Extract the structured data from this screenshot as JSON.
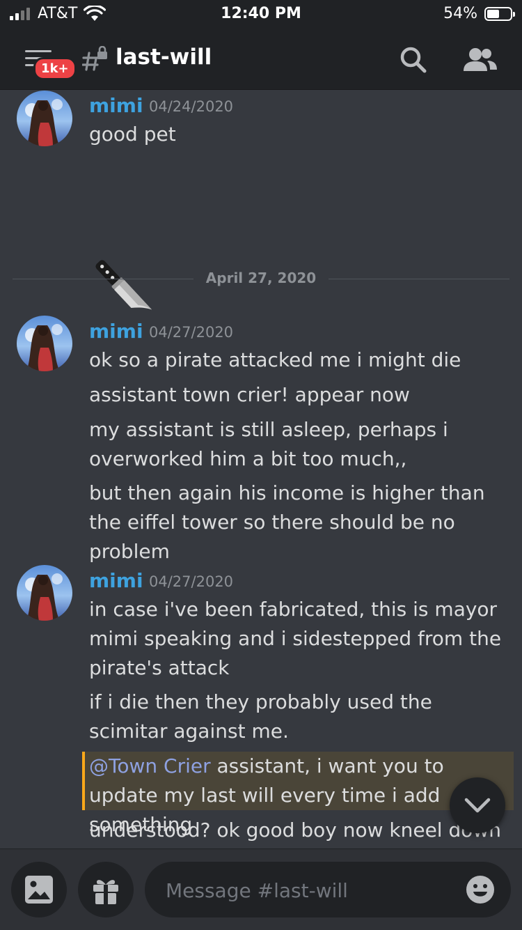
{
  "status_bar": {
    "carrier": "AT&T",
    "time": "12:40 PM",
    "battery_percent": "54%",
    "battery_level": 0.54
  },
  "header": {
    "unread_badge": "1k+",
    "channel_name": "last-will",
    "icons": [
      "menu-icon",
      "locked-channel-icon",
      "search-icon",
      "members-icon"
    ]
  },
  "messages": [
    {
      "author": "mimi",
      "timestamp": "04/24/2020",
      "lines": [
        "good pet"
      ],
      "emoji": "kitchen-knife"
    },
    {
      "author": "mimi",
      "timestamp": "04/27/2020",
      "lines": [
        "ok so a pirate attacked me i might die",
        "assistant town crier! appear now",
        "my assistant is still asleep, perhaps i overworked him a bit too much,,",
        "but then again his income is higher than the eiffel tower so there should be no problem"
      ]
    },
    {
      "author": "mimi",
      "timestamp": "04/27/2020",
      "lines": [
        "in case i've been fabricated, this is mayor mimi speaking and i sidestepped from the pirate's attack",
        "if i die then they probably used the scimitar against me.",
        "understood? ok good boy now kneel down"
      ],
      "mention_line": {
        "mention": "@Town Crier",
        "text": " assistant, i want you to update my last will every time i add something"
      }
    }
  ],
  "date_divider": "April 27, 2020",
  "composer": {
    "placeholder": "Message #last-will",
    "icons": [
      "image-icon",
      "gift-icon",
      "emoji-icon"
    ]
  },
  "colors": {
    "background": "#36393f",
    "header": "#202225",
    "username": "#3ea2df",
    "mention_highlight": "#4a4538",
    "mention_bar": "#faa81a",
    "mention_text": "#8ea1e1",
    "badge": "#ed4245"
  }
}
